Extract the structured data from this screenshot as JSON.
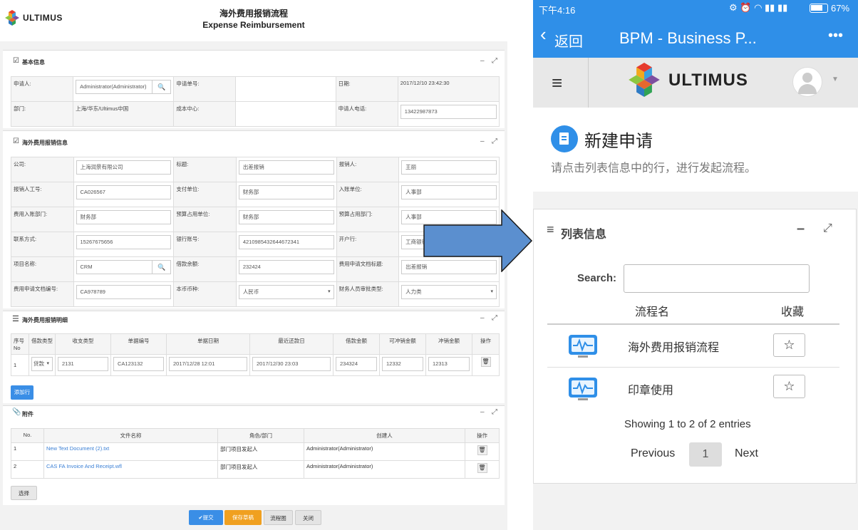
{
  "left": {
    "logo_text": "ULTIMUS",
    "title_cn": "海外费用报销流程",
    "title_en": "Expense Reimbursement",
    "basic": {
      "title": "基本信息",
      "applicant_label": "申请人:",
      "applicant_value": "Administrator(Administrator)",
      "app_no_label": "申请单号:",
      "date_label": "日期:",
      "date_value": "2017/12/10 23:42:30",
      "dept_label": "部门:",
      "dept_value": "上海/华东/Ultimus中国",
      "cost_center_label": "成本中心:",
      "phone_label": "申请人电话:",
      "phone_value": "13422987873"
    },
    "overseas": {
      "title": "海外费用报销信息",
      "rows": [
        [
          {
            "label": "公司:",
            "value": "上海润景有限公司"
          },
          {
            "label": "标题:",
            "value": "出差报销"
          },
          {
            "label": "报销人:",
            "value": "王丽"
          }
        ],
        [
          {
            "label": "报销人工号:",
            "value": "CA026567"
          },
          {
            "label": "支付单位:",
            "value": "财务部"
          },
          {
            "label": "入账单位:",
            "value": "人事部"
          }
        ],
        [
          {
            "label": "费用入账部门:",
            "value": "财务部"
          },
          {
            "label": "预算占用单位:",
            "value": "财务部"
          },
          {
            "label": "预算占用部门:",
            "value": "人事部"
          }
        ],
        [
          {
            "label": "联系方式:",
            "value": "15267675656"
          },
          {
            "label": "银行账号:",
            "value": "4210985432644672341"
          },
          {
            "label": "开户行:",
            "value": "工商银行"
          }
        ],
        [
          {
            "label": "项目名称:",
            "value": "CRM"
          },
          {
            "label": "借款余额:",
            "value": "232424"
          },
          {
            "label": "费用申请文档标题:",
            "value": "出差报销"
          }
        ],
        [
          {
            "label": "费用申请文档编号:",
            "value": "CA978789"
          },
          {
            "label": "本币币种:",
            "value": "人民币"
          },
          {
            "label": "财务人员审批类型:",
            "value": "人力类"
          }
        ]
      ]
    },
    "detail": {
      "title": "海外费用报销明细",
      "headers": [
        "序号No",
        "借款类型",
        "收支类型",
        "单据编号",
        "单据日期",
        "最近还款日",
        "借款金额",
        "可冲销金额",
        "冲销金额",
        "操作"
      ],
      "row": {
        "no": "1",
        "loan_type": "贷款",
        "pay_type": "2131",
        "doc_no": "CA123132",
        "doc_date": "2017/12/28 12:01",
        "due_date": "2017/12/30 23:03",
        "loan_amt": "234324",
        "offset_avail": "12332",
        "offset_amt": "12313"
      },
      "add_row_label": "添加行"
    },
    "attach": {
      "title": "附件",
      "headers": [
        "No.",
        "文件名称",
        "角色/部门",
        "创建人",
        "操作"
      ],
      "rows": [
        {
          "no": "1",
          "file": "New Text Document (2).txt",
          "role": "部门项目发起人",
          "creator": "Administrator(Administrator)"
        },
        {
          "no": "2",
          "file": "CAS FA Invoice And Receipt.wfl",
          "role": "部门项目发起人",
          "creator": "Administrator(Administrator)"
        }
      ],
      "select_label": "选择"
    },
    "actions": {
      "submit": "提交",
      "save_draft": "保存草稿",
      "flow_chart": "流程图",
      "close": "关闭"
    }
  },
  "right": {
    "status": {
      "time": "下午4:16",
      "battery": "67%"
    },
    "nav": {
      "back": "返回",
      "title": "BPM - Business P...",
      "more": "•••"
    },
    "logo_text": "ULTIMUS",
    "heading": "新建申请",
    "subtitle": "请点击列表信息中的行，进行发起流程。",
    "list": {
      "title": "列表信息",
      "search_label": "Search:",
      "col_name": "流程名",
      "col_fav": "收藏",
      "rows": [
        {
          "name": "海外费用报销流程"
        },
        {
          "name": "印章使用"
        }
      ],
      "info": "Showing 1 to 2 of 2 entries",
      "prev": "Previous",
      "page": "1",
      "next": "Next"
    }
  },
  "colors": {
    "brand_blue": "#2f8fe8",
    "arrow_fill": "#5b8fcf",
    "button_blue": "#3a8ee6",
    "button_orange": "#f0a020"
  }
}
